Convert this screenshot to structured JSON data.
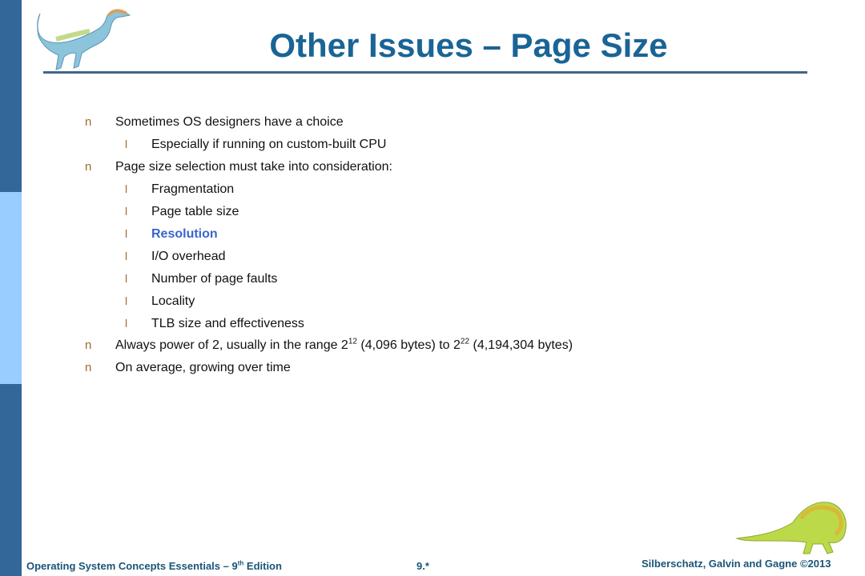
{
  "slide": {
    "title": "Other Issues – Page Size",
    "colors": {
      "title": "#1a6496",
      "rule": "#3f6688",
      "sidebar_dark": "#336699",
      "sidebar_light": "#99ccff",
      "bullet": "#9c6b30",
      "highlight": "#3a66cc",
      "footer": "#1a5577"
    },
    "bullets": [
      {
        "level": 1,
        "marker": "n",
        "text": "Sometimes OS designers have a choice"
      },
      {
        "level": 2,
        "marker": "l",
        "text": "Especially if running on custom-built CPU"
      },
      {
        "level": 1,
        "marker": "n",
        "text": "Page size selection must take into consideration:"
      },
      {
        "level": 2,
        "marker": "l",
        "text": "Fragmentation"
      },
      {
        "level": 2,
        "marker": "l",
        "text": "Page table size"
      },
      {
        "level": 2,
        "marker": "l",
        "text": "Resolution",
        "highlighted": true
      },
      {
        "level": 2,
        "marker": "l",
        "text": "I/O overhead"
      },
      {
        "level": 2,
        "marker": "l",
        "text": "Number of page faults"
      },
      {
        "level": 2,
        "marker": "l",
        "text": "Locality"
      },
      {
        "level": 2,
        "marker": "l",
        "text": "TLB size and effectiveness"
      },
      {
        "level": 1,
        "marker": "n",
        "parts": {
          "a": "Always power of 2, usually in the range 2",
          "sup1": "12",
          "b": " (4,096 bytes) to 2",
          "sup2": "22",
          "c": " (4,194,304 bytes)"
        }
      },
      {
        "level": 1,
        "marker": "n",
        "text": "On average, growing over time"
      }
    ],
    "footer": {
      "left_a": "Operating System Concepts Essentials – 9",
      "left_sup": "th",
      "left_b": " Edition",
      "page": "9.*",
      "right": "Silberschatz, Galvin and Gagne ©2013"
    },
    "images": {
      "top_left": "dinosaur-illustration",
      "bottom_right": "dinosaur-illustration"
    }
  }
}
